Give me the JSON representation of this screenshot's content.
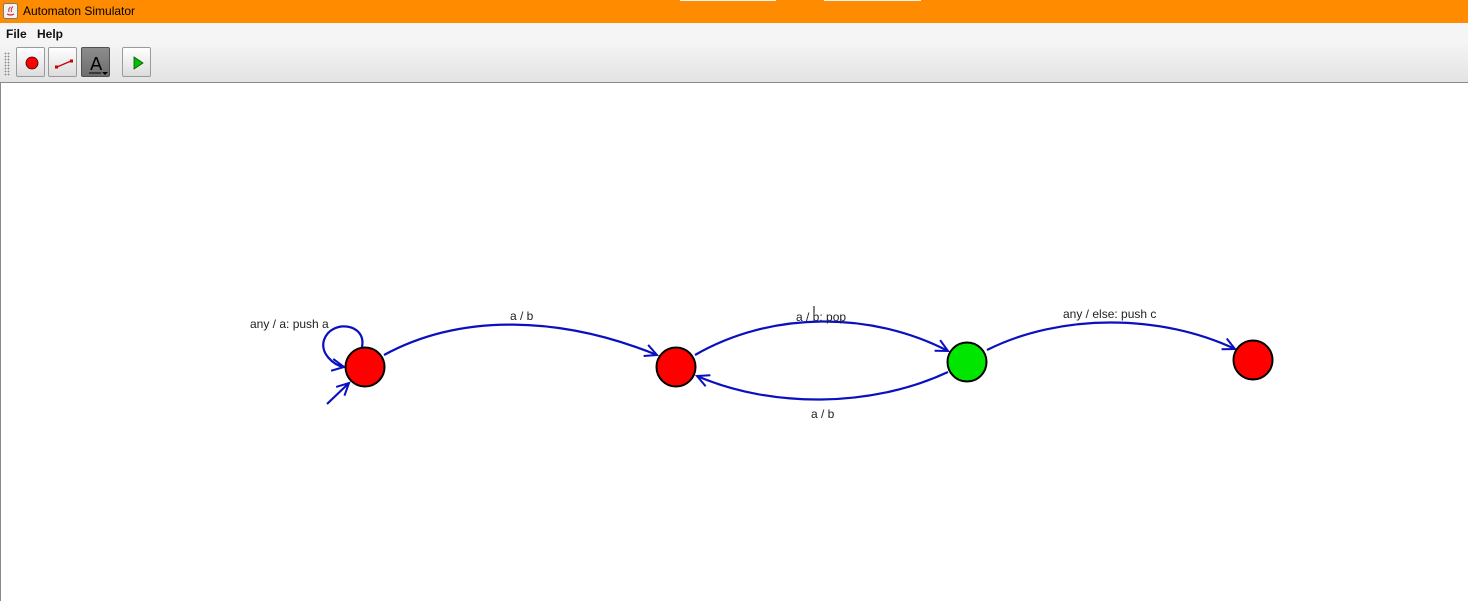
{
  "window": {
    "title": "Automaton Simulator"
  },
  "menu": [
    {
      "label": "File"
    },
    {
      "label": "Help"
    }
  ],
  "toolbar": {
    "tools": [
      {
        "name": "add-state-tool",
        "icon": "red-dot-icon"
      },
      {
        "name": "add-transition-tool",
        "icon": "transition-line-icon"
      },
      {
        "name": "text-tool",
        "icon": "text-a-icon",
        "active": true
      },
      {
        "name": "run-tool",
        "icon": "play-icon"
      }
    ]
  },
  "automaton": {
    "states": [
      {
        "id": "q0",
        "color": "#ff0000",
        "initial": true
      },
      {
        "id": "q1",
        "color": "#ff0000"
      },
      {
        "id": "q2",
        "color": "#00e600"
      },
      {
        "id": "q3",
        "color": "#ff0000"
      }
    ],
    "transitions": [
      {
        "from": "q0",
        "to": "q0",
        "label": "any / a: push a"
      },
      {
        "from": "q0",
        "to": "q1",
        "label": "a / b"
      },
      {
        "from": "q1",
        "to": "q2",
        "label": "a / b: pop"
      },
      {
        "from": "q2",
        "to": "q1",
        "label": "a / b"
      },
      {
        "from": "q2",
        "to": "q3",
        "label": "any / else: push c"
      }
    ],
    "edge_color": "#0a10c0"
  }
}
